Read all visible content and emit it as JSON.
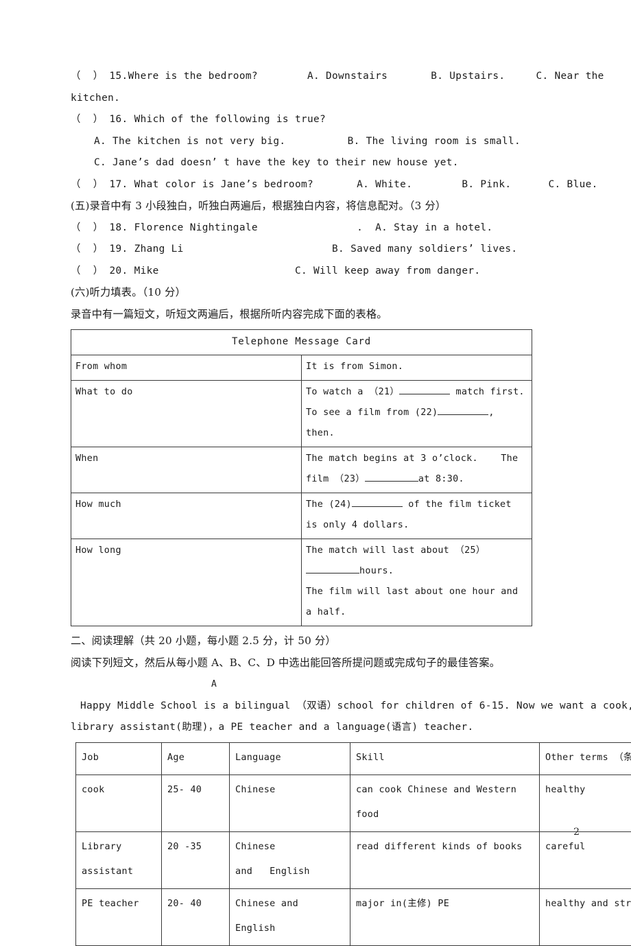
{
  "page": {
    "number": "2"
  },
  "listening": {
    "q15": {
      "line1": "（  ） 15.Where is the bedroom?        A. Downstairs       B. Upstairs.     C. Near the",
      "line2": "kitchen."
    },
    "q16": {
      "stem": "（  ） 16. Which of the following is true?",
      "optA_B": "A. The kitchen is not very big.          B. The living room is small.",
      "optC": "C. Jane’s dad doesn’ t have the key to their new house yet."
    },
    "q17": "（  ） 17. What color is Jane’s bedroom?       A. White.        B. Pink.      C. Blue.",
    "section5_heading": "(五)录音中有 3 小段独白，听独白两遍后，根据独白内容，将信息配对。（3 分）",
    "q18": "（  ） 18. Florence Nightingale                .  A. Stay in a hotel.",
    "q19": "（  ） 19. Zhang Li                        B. Saved many soldiers’ lives.",
    "q20": "（  ） 20. Mike                      C. Will keep away from danger.",
    "section6_heading": "(六)听力填表。（10 分）",
    "section6_instruction": "录音中有一篇短文，听短文两遍后，根据所听内容完成下面的表格。"
  },
  "message_card": {
    "title": "Telephone Message Card",
    "rows": [
      {
        "label": "From whom",
        "lines": [
          "It is from Simon."
        ]
      },
      {
        "label": "What to do",
        "lines": [
          "To watch a （21）",
          " match first.",
          "To see a film from (22)",
          ", then."
        ]
      },
      {
        "label": "When",
        "lines": [
          "The match begins at 3 o’clock.    The film （23）",
          "at 8:30."
        ]
      },
      {
        "label": "How much",
        "lines": [
          "The (24)",
          " of the film ticket is only 4 dollars."
        ]
      },
      {
        "label": "How long",
        "lines": [
          "The match will last about （25）",
          "hours.",
          "The film will last about one hour and a half."
        ]
      }
    ]
  },
  "reading": {
    "section_heading": "二、阅读理解（共 20 小题，每小题 2.5 分，计 50 分）",
    "instruction": "阅读下列短文，然后从每小题 A、B、C、D 中选出能回答所提问题或完成句子的最佳答案。",
    "passage_label": "A",
    "passage_line1": "Happy Middle School is a bilingual （双语）school for children of 6-15. Now we want a cook,",
    "passage_line2": "library assistant(助理)，a PE teacher and a language(语言) teacher."
  },
  "job_table": {
    "headers": [
      "Job",
      "Age",
      "Language",
      "Skill",
      "Other terms （条件）"
    ],
    "rows": [
      {
        "job": "cook",
        "age": "25- 40",
        "language": "Chinese",
        "skill": "can cook Chinese and Western\nfood",
        "other": "healthy"
      },
      {
        "job": "Library\nassistant",
        "age": "20 -35",
        "language": "Chinese\nand   English",
        "skill": "read different kinds of books",
        "other": "careful"
      },
      {
        "job": "PE teacher",
        "age": "20- 40",
        "language": "Chinese and\nEnglish",
        "skill": "major in(主修) PE",
        "other": "healthy and strong"
      }
    ]
  }
}
